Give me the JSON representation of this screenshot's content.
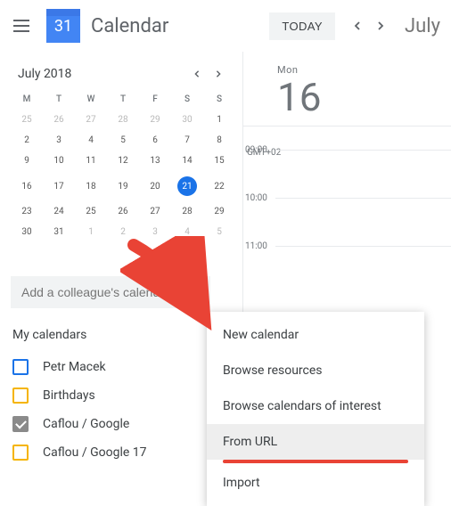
{
  "header": {
    "logo_date": "31",
    "app_title": "Calendar",
    "today_btn": "TODAY",
    "month_label": "July"
  },
  "mini_cal": {
    "title": "July 2018",
    "day_headers": [
      "M",
      "T",
      "W",
      "T",
      "F",
      "S",
      "S"
    ],
    "rows": [
      [
        {
          "d": "25",
          "o": true
        },
        {
          "d": "26",
          "o": true
        },
        {
          "d": "27",
          "o": true
        },
        {
          "d": "28",
          "o": true
        },
        {
          "d": "29",
          "o": true
        },
        {
          "d": "30",
          "o": true
        },
        {
          "d": "1"
        }
      ],
      [
        {
          "d": "2"
        },
        {
          "d": "3"
        },
        {
          "d": "4"
        },
        {
          "d": "5"
        },
        {
          "d": "6"
        },
        {
          "d": "7"
        },
        {
          "d": "8"
        }
      ],
      [
        {
          "d": "9"
        },
        {
          "d": "10"
        },
        {
          "d": "11"
        },
        {
          "d": "12"
        },
        {
          "d": "13"
        },
        {
          "d": "14"
        },
        {
          "d": "15"
        }
      ],
      [
        {
          "d": "16"
        },
        {
          "d": "17"
        },
        {
          "d": "18"
        },
        {
          "d": "19"
        },
        {
          "d": "20"
        },
        {
          "d": "21",
          "sel": true
        },
        {
          "d": "22"
        }
      ],
      [
        {
          "d": "23"
        },
        {
          "d": "24"
        },
        {
          "d": "25"
        },
        {
          "d": "26"
        },
        {
          "d": "27"
        },
        {
          "d": "28"
        },
        {
          "d": "29"
        }
      ],
      [
        {
          "d": "30"
        },
        {
          "d": "31"
        },
        {
          "d": "1",
          "o": true
        },
        {
          "d": "2",
          "o": true
        },
        {
          "d": "3",
          "o": true
        },
        {
          "d": "4",
          "o": true
        },
        {
          "d": "5",
          "o": true
        }
      ]
    ]
  },
  "sidebar": {
    "add_colleague_placeholder": "Add a colleague's calendar",
    "my_calendars_label": "My calendars",
    "calendars": [
      {
        "label": "Petr Macek",
        "color": "#1a73e8",
        "checked": false
      },
      {
        "label": "Birthdays",
        "color": "#f5b400",
        "checked": false
      },
      {
        "label": "Caflou / Google",
        "color": "#8a8a8a",
        "checked": true
      },
      {
        "label": "Caflou / Google 17",
        "color": "#f5b400",
        "checked": false
      }
    ]
  },
  "day_view": {
    "dow": "Mon",
    "dnum": "16",
    "tz": "GMT+02",
    "times": [
      "09:00",
      "10:00",
      "11:00"
    ]
  },
  "popup": {
    "items": [
      {
        "label": "New calendar"
      },
      {
        "label": "Browse resources"
      },
      {
        "label": "Browse calendars of interest"
      },
      {
        "label": "From URL",
        "hover": true,
        "underline": true
      },
      {
        "label": "Import"
      }
    ]
  }
}
